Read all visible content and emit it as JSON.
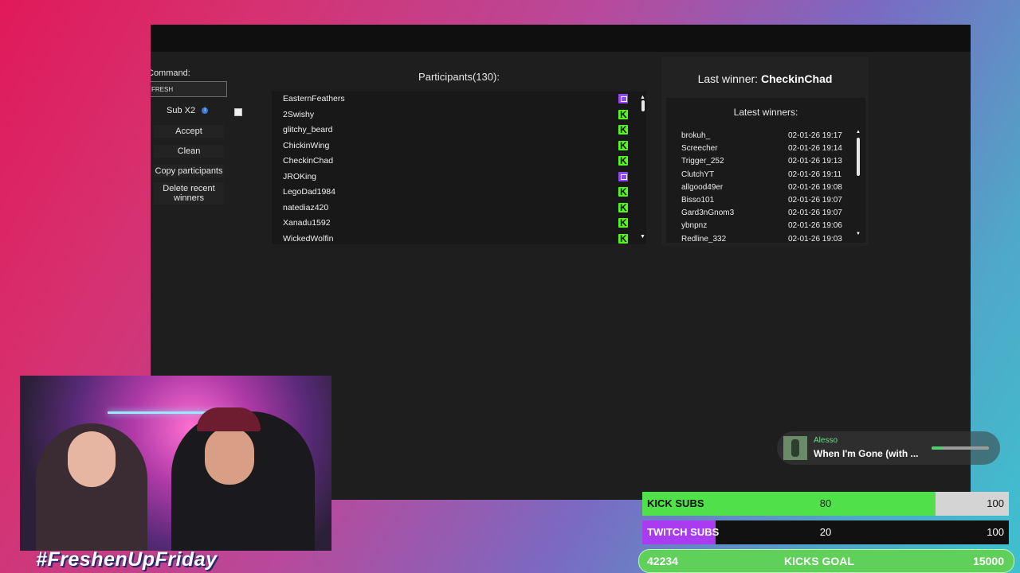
{
  "command": {
    "label": "Command:",
    "value": "FRESH"
  },
  "controls": {
    "sub_x2_label": "Sub X2",
    "accept": "Accept",
    "clean": "Clean",
    "copy_participants": "Copy participants",
    "delete_recent_winners": "Delete recent winners"
  },
  "participants": {
    "title": "Participants(130):",
    "list": [
      {
        "name": "EasternFeathers",
        "platform": "twitch"
      },
      {
        "name": "2Swishy",
        "platform": "kick"
      },
      {
        "name": "glitchy_beard",
        "platform": "kick"
      },
      {
        "name": "ChickinWing",
        "platform": "kick"
      },
      {
        "name": "CheckinChad",
        "platform": "kick"
      },
      {
        "name": "JROKing",
        "platform": "twitch"
      },
      {
        "name": "LegoDad1984",
        "platform": "kick"
      },
      {
        "name": "natediaz420",
        "platform": "kick"
      },
      {
        "name": "Xanadu1592",
        "platform": "kick"
      },
      {
        "name": "WickedWolfin",
        "platform": "kick"
      }
    ]
  },
  "winners": {
    "last_winner_label": "Last winner: ",
    "last_winner_name": "CheckinChad",
    "latest_title": "Latest winners:",
    "list": [
      {
        "name": "brokuh_",
        "date": "02-01-26 19:17"
      },
      {
        "name": "Screecher",
        "date": "02-01-26 19:14"
      },
      {
        "name": "Trigger_252",
        "date": "02-01-26 19:13"
      },
      {
        "name": "ClutchYT",
        "date": "02-01-26 19:11"
      },
      {
        "name": "allgood49er",
        "date": "02-01-26 19:08"
      },
      {
        "name": "Bisso101",
        "date": "02-01-26 19:07"
      },
      {
        "name": "Gard3nGnom3",
        "date": "02-01-26 19:07"
      },
      {
        "name": "ybnpnz",
        "date": "02-01-26 19:06"
      },
      {
        "name": "Redline_332",
        "date": "02-01-26 19:03"
      }
    ]
  },
  "now_playing": {
    "artist": "Alesso",
    "title": "When I'm Gone (with ...",
    "progress": 0.2
  },
  "overlay": {
    "hashtag": "#FreshenUpFriday",
    "kick_subs": {
      "label": "KICK SUBS",
      "current": "80",
      "target": "100",
      "fraction": 0.8
    },
    "twitch_subs": {
      "label": "TWITCH SUBS",
      "current": "20",
      "target": "100",
      "fraction": 0.2
    },
    "kicks_goal": {
      "current": "42234",
      "label": "KICKS GOAL",
      "target": "15000"
    }
  },
  "colors": {
    "kick_green": "#53fc18",
    "twitch_purple": "#9146ff",
    "app_bg": "#1d1d1d"
  }
}
